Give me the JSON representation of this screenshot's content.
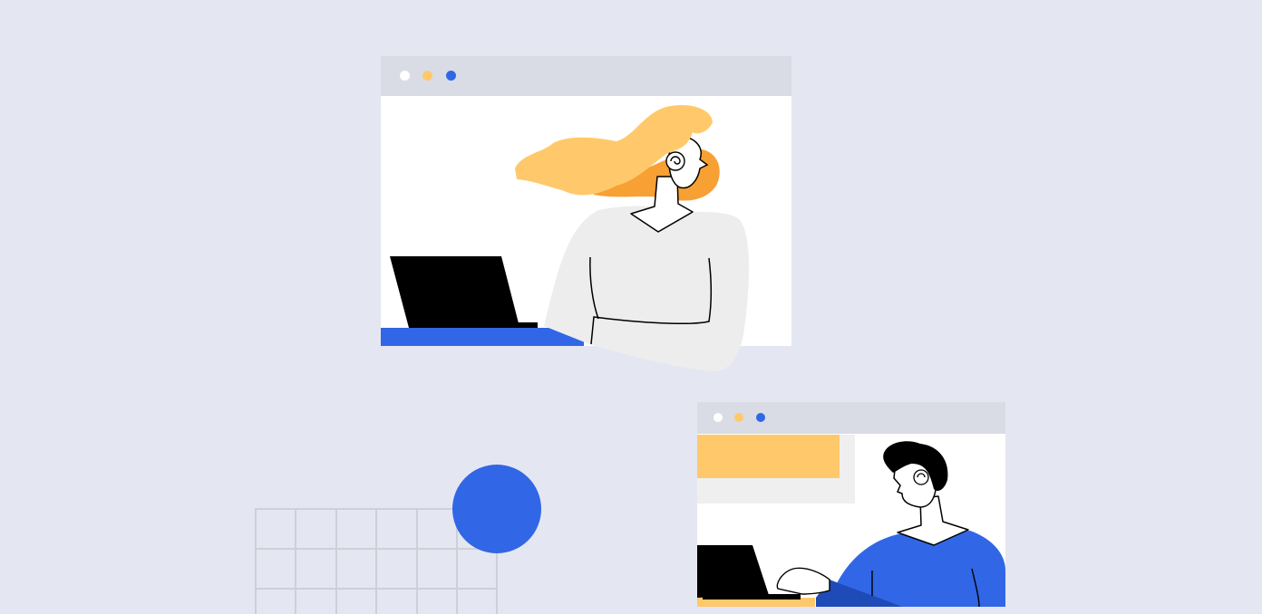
{
  "scene": {
    "colors": {
      "background": "#E4E7F1",
      "window_bar": "#D9DCE4",
      "window_body": "#FFFFFF",
      "dot_white": "#FFFFFF",
      "dot_yellow": "#FFC96B",
      "dot_blue": "#3166E6",
      "accent_blue": "#3166E6",
      "hair_yellow": "#FFC96B",
      "hair_orange": "#F7A033",
      "sweater_gray": "#EDEDED",
      "laptop_black": "#000000",
      "grid_line": "#CDD0D8"
    },
    "icons": [
      "window-close-dot",
      "window-minimize-dot",
      "window-maximize-dot"
    ]
  }
}
